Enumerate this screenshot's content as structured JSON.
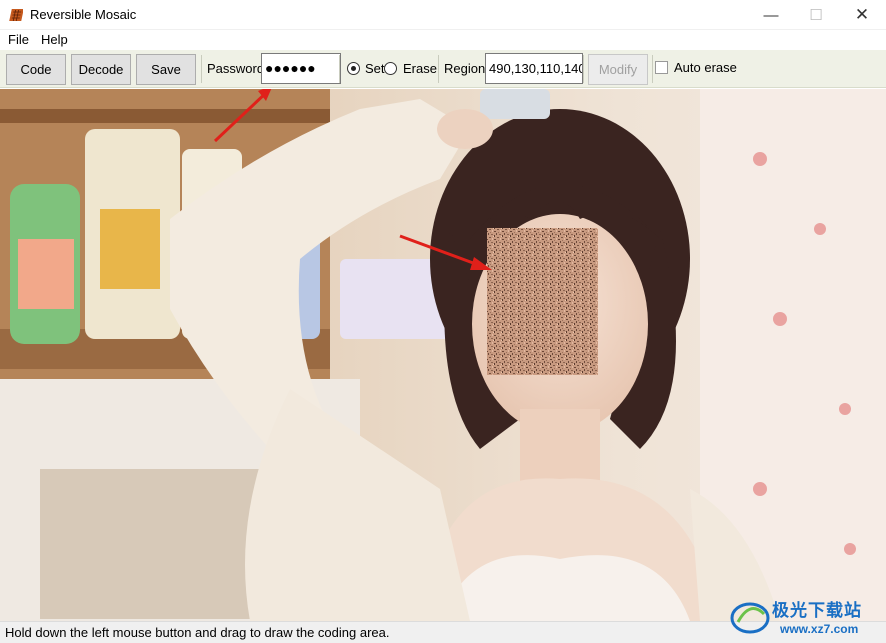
{
  "window": {
    "title": "Reversible Mosaic",
    "minimize_glyph": "—",
    "maximize_glyph": "☐",
    "close_glyph": "✕"
  },
  "menu": {
    "items": [
      {
        "label": "File"
      },
      {
        "label": "Help"
      }
    ]
  },
  "toolbar": {
    "code_label": "Code",
    "decode_label": "Decode",
    "save_label": "Save",
    "password_label": "Password",
    "password_value": "●●●●●●",
    "mode_options": [
      {
        "label": "Set",
        "selected": true
      },
      {
        "label": "Erase",
        "selected": false
      }
    ],
    "region_label": "Region",
    "region_value": "490,130,110,140",
    "modify_label": "Modify",
    "modify_enabled": false,
    "auto_erase_label": "Auto erase",
    "auto_erase_checked": false
  },
  "canvas": {
    "image_subject": "photo of a girl in a white knit cardigan with a mosaic-coded face region",
    "mosaic_color": "#c89a80",
    "arrow_color": "#e0201a"
  },
  "status": {
    "text": "Hold down the left mouse button and drag to draw the coding area."
  },
  "watermark": {
    "brand": "极光下载站",
    "url": "www.xz7.com",
    "color": "#1a6fc4"
  },
  "colors": {
    "toolbar_bg": "#eff1e6",
    "accent_arrow": "#e0201a"
  }
}
